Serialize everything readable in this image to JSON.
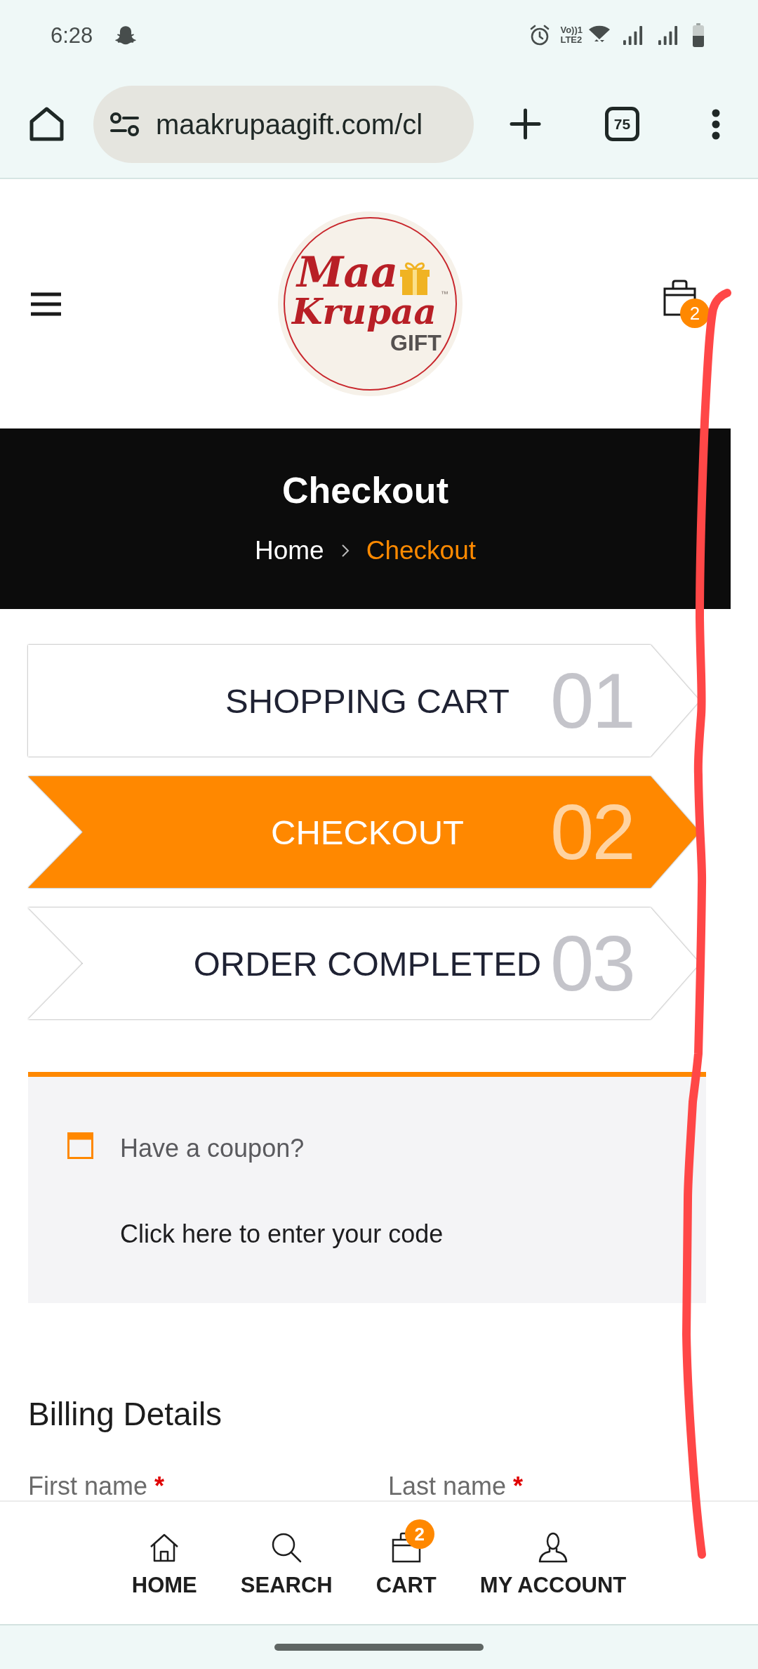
{
  "status_bar": {
    "time": "6:28",
    "network_lines": [
      "Vo))1",
      "LTE2"
    ]
  },
  "browser": {
    "url": "maakrupaagift.com/cl",
    "tab_count": "75"
  },
  "header": {
    "logo": {
      "line_1": "Maa",
      "line_2": "Krupaa",
      "tagline": "GIFT",
      "trademark": "™"
    },
    "cart_count": "2"
  },
  "page_title": {
    "title": "Checkout",
    "breadcrumb": [
      {
        "label": "Home",
        "current": false
      },
      {
        "label": "Checkout",
        "current": true
      }
    ]
  },
  "steps": [
    {
      "label": "SHOPPING CART",
      "number": "01",
      "selected": false
    },
    {
      "label": "CHECKOUT",
      "number": "02",
      "selected": true
    },
    {
      "label": "ORDER COMPLETED",
      "number": "03",
      "selected": false
    }
  ],
  "coupon_notice": {
    "prompt": "Have a coupon?",
    "link": "Click here to enter your code"
  },
  "billing": {
    "heading": "Billing Details",
    "fields": [
      {
        "label": "First name",
        "required_mark": "*"
      },
      {
        "label": "Last name",
        "required_mark": "*"
      }
    ]
  },
  "bottom_nav": [
    {
      "kind": "home",
      "label": "HOME"
    },
    {
      "kind": "search",
      "label": "SEARCH"
    },
    {
      "kind": "cart",
      "label": "CART",
      "badge": "2"
    },
    {
      "kind": "account",
      "label": "MY ACCOUNT"
    }
  ]
}
